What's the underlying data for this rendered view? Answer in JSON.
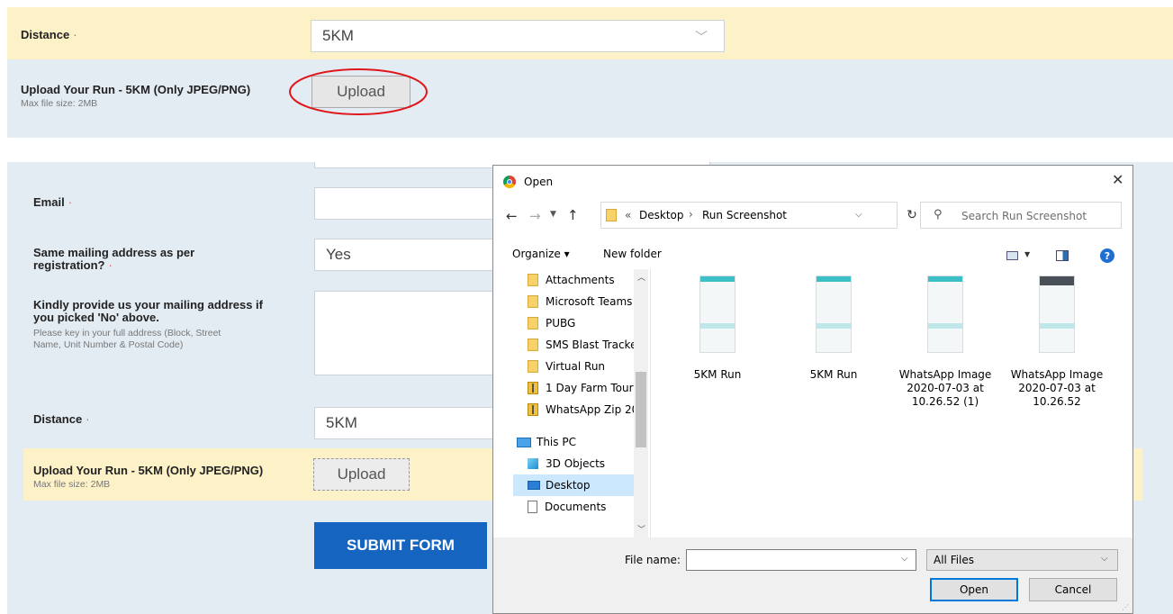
{
  "top_form": {
    "distance_label": "Distance",
    "required_mark": "·",
    "distance_value": "5KM",
    "upload_label": "Upload Your Run - 5KM (Only JPEG/PNG)",
    "upload_hint": "Max file size: 2MB",
    "upload_button": "Upload"
  },
  "form": {
    "email_label": "Email",
    "same_address_label_1": "Same mailing address as per",
    "same_address_label_2": "registration?",
    "same_address_value": "Yes",
    "mailing_label_1": "Kindly provide us your mailing address if",
    "mailing_label_2": "you picked 'No' above.",
    "mailing_hint_1": "Please key in your full address (Block, Street",
    "mailing_hint_2": "Name, Unit Number & Postal Code)",
    "distance_label": "Distance",
    "distance_value": "5KM",
    "upload_label": "Upload Your Run - 5KM (Only JPEG/PNG)",
    "upload_hint": "Max file size: 2MB",
    "upload_button": "Upload",
    "submit_button": "SUBMIT FORM"
  },
  "dialog": {
    "title": "Open",
    "path_prefix": "«",
    "path_1": "Desktop",
    "path_sep": "›",
    "path_2": "Run Screenshot",
    "search_placeholder": "Search Run Screenshot",
    "organize": "Organize ▾",
    "new_folder": "New folder",
    "tree": [
      {
        "label": "Attachments",
        "icon": "folder-icon"
      },
      {
        "label": "Microsoft Teams",
        "icon": "folder-icon"
      },
      {
        "label": "PUBG",
        "icon": "folder-icon"
      },
      {
        "label": "SMS Blast Tracke",
        "icon": "folder-icon"
      },
      {
        "label": "Virtual Run",
        "icon": "folder-icon"
      },
      {
        "label": "1 Day Farm Tour",
        "icon": "zip-folder-icon"
      },
      {
        "label": "WhatsApp Zip 20",
        "icon": "zip-folder-icon"
      }
    ],
    "this_pc": "This PC",
    "objects_3d": "3D Objects",
    "desktop": "Desktop",
    "documents": "Documents",
    "files": [
      {
        "line1": "5KM Run",
        "line2": "",
        "line3": ""
      },
      {
        "line1": "5KM Run",
        "line2": "",
        "line3": ""
      },
      {
        "line1": "WhatsApp Image",
        "line2": "2020-07-03 at",
        "line3": "10.26.52 (1)"
      },
      {
        "line1": "WhatsApp Image",
        "line2": "2020-07-03 at",
        "line3": "10.26.52"
      }
    ],
    "file_name_label": "File name:",
    "file_name_value": "",
    "filter_value": "All Files",
    "open_button": "Open",
    "cancel_button": "Cancel"
  },
  "colors": {
    "highlight_row": "#fdf1c7",
    "form_bg": "#e4ecf3",
    "submit": "#1565c0",
    "annotation_circle": "#e0161b"
  }
}
